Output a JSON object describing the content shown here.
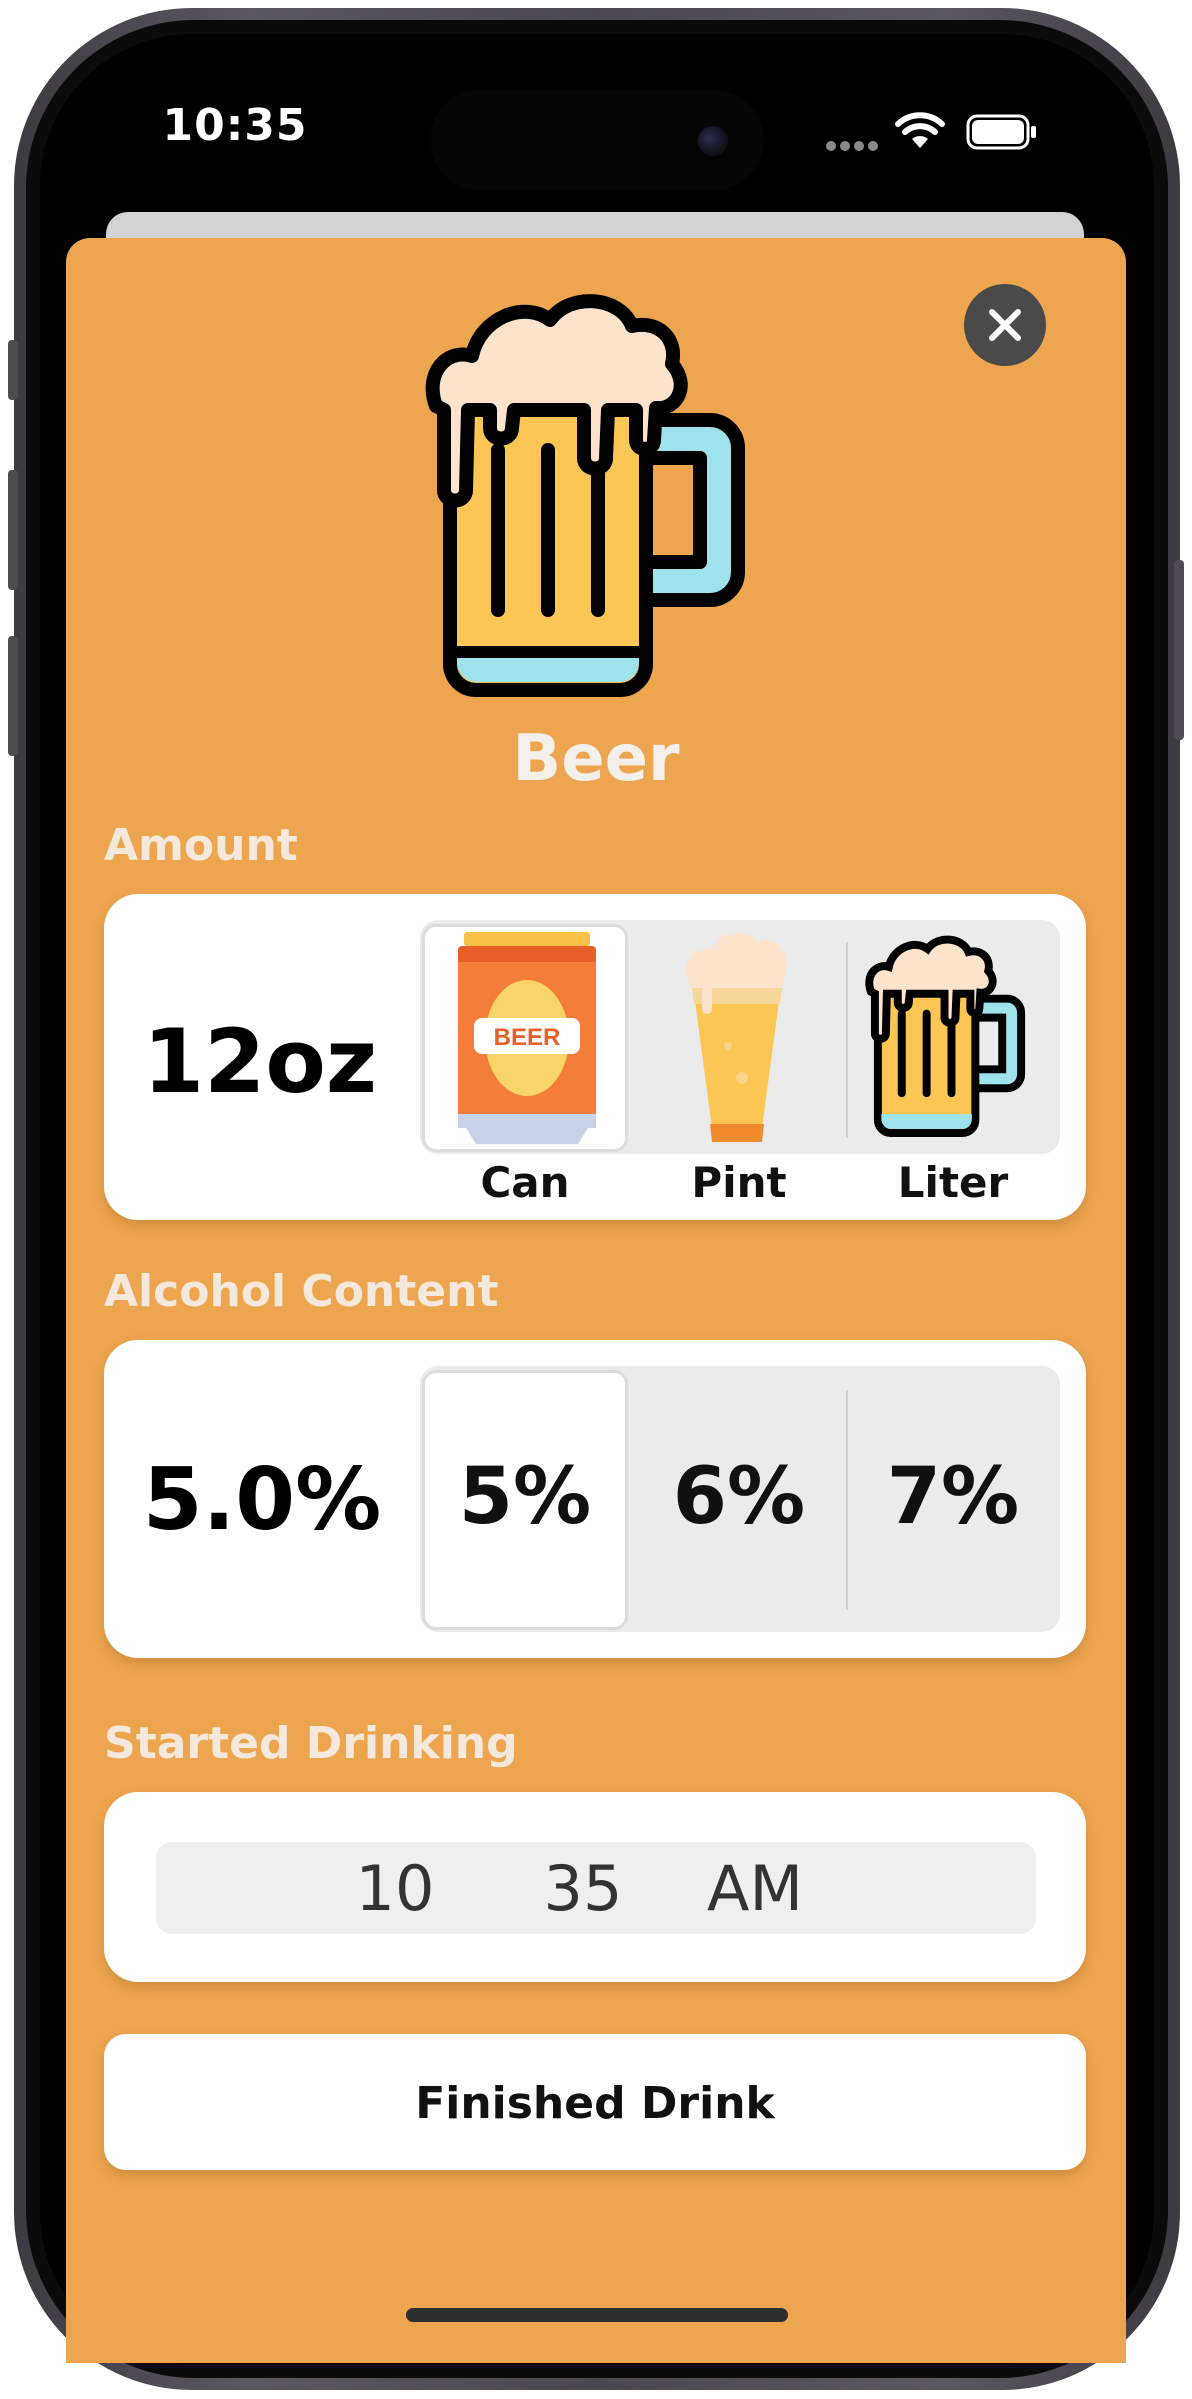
{
  "status_bar": {
    "time": "10:35"
  },
  "drink": {
    "name": "Beer"
  },
  "amount": {
    "label": "Amount",
    "value": "12oz",
    "options": [
      {
        "label": "Can",
        "selected": true,
        "icon": "beer-can-icon",
        "can_text": "BEER"
      },
      {
        "label": "Pint",
        "selected": false,
        "icon": "pint-glass-icon"
      },
      {
        "label": "Liter",
        "selected": false,
        "icon": "beer-mug-icon"
      }
    ]
  },
  "alcohol": {
    "label": "Alcohol Content",
    "value": "5.0%",
    "options": [
      {
        "label": "5%",
        "selected": true
      },
      {
        "label": "6%",
        "selected": false
      },
      {
        "label": "7%",
        "selected": false
      }
    ]
  },
  "started": {
    "label": "Started Drinking",
    "hour": "10",
    "minute": "35",
    "period": "AM"
  },
  "finish_button": {
    "label": "Finished Drink"
  },
  "colors": {
    "sheet": "#eea54f",
    "beer": "#fbc653",
    "foam": "#fde3cc",
    "glass_base": "#9ee3ec",
    "can": "#f57d3a"
  }
}
